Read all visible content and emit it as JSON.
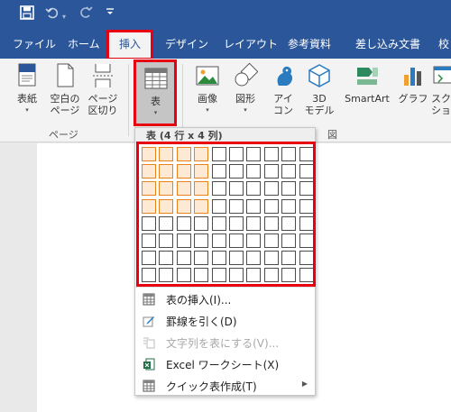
{
  "qat": {
    "save_icon": "save-icon",
    "undo_icon": "undo-icon",
    "redo_icon": "redo-icon",
    "customize_icon": "customize-qat-icon"
  },
  "tabs": [
    {
      "label": "ファイル"
    },
    {
      "label": "ホーム"
    },
    {
      "label": "挿入"
    },
    {
      "label": "デザイン"
    },
    {
      "label": "レイアウト"
    },
    {
      "label": "参考資料"
    },
    {
      "label": "差し込み文書"
    },
    {
      "label": "校"
    }
  ],
  "ribbon": {
    "pages_group": {
      "label": "ページ",
      "cover": {
        "line1": "表紙"
      },
      "blank": {
        "line1": "空白の",
        "line2": "ページ"
      },
      "break": {
        "line1": "ページ",
        "line2": "区切り"
      }
    },
    "table_group": {
      "table": {
        "line1": "表"
      }
    },
    "illustrations_group": {
      "label": "図",
      "picture": {
        "line1": "画像"
      },
      "shapes": {
        "line1": "図形"
      },
      "icons": {
        "line1": "アイ",
        "line2": "コン"
      },
      "models3d": {
        "line1": "3D",
        "line2": "モデル"
      },
      "smartart": {
        "line1": "SmartArt"
      },
      "chart": {
        "line1": "グラフ"
      },
      "screenshot": {
        "line1": "スク",
        "line2": "ショ"
      }
    }
  },
  "dropdown": {
    "header": "表 (4 行 x 4 列)",
    "grid": {
      "rows": 8,
      "cols": 10,
      "selected_rows": 4,
      "selected_cols": 4
    },
    "items": [
      {
        "label": "表の挿入(I)...",
        "disabled": false,
        "submenu": false
      },
      {
        "label": "罫線を引く(D)",
        "disabled": false,
        "submenu": false
      },
      {
        "label": "文字列を表にする(V)...",
        "disabled": true,
        "submenu": false
      },
      {
        "label": "Excel ワークシート(X)",
        "disabled": false,
        "submenu": false
      },
      {
        "label": "クイック表作成(T)",
        "disabled": false,
        "submenu": true
      }
    ]
  },
  "colors": {
    "title_bar": "#2b579a",
    "highlight_red": "#e60012",
    "selected_cell": "#e8821c",
    "ribbon_bg": "#f3f3f3"
  }
}
